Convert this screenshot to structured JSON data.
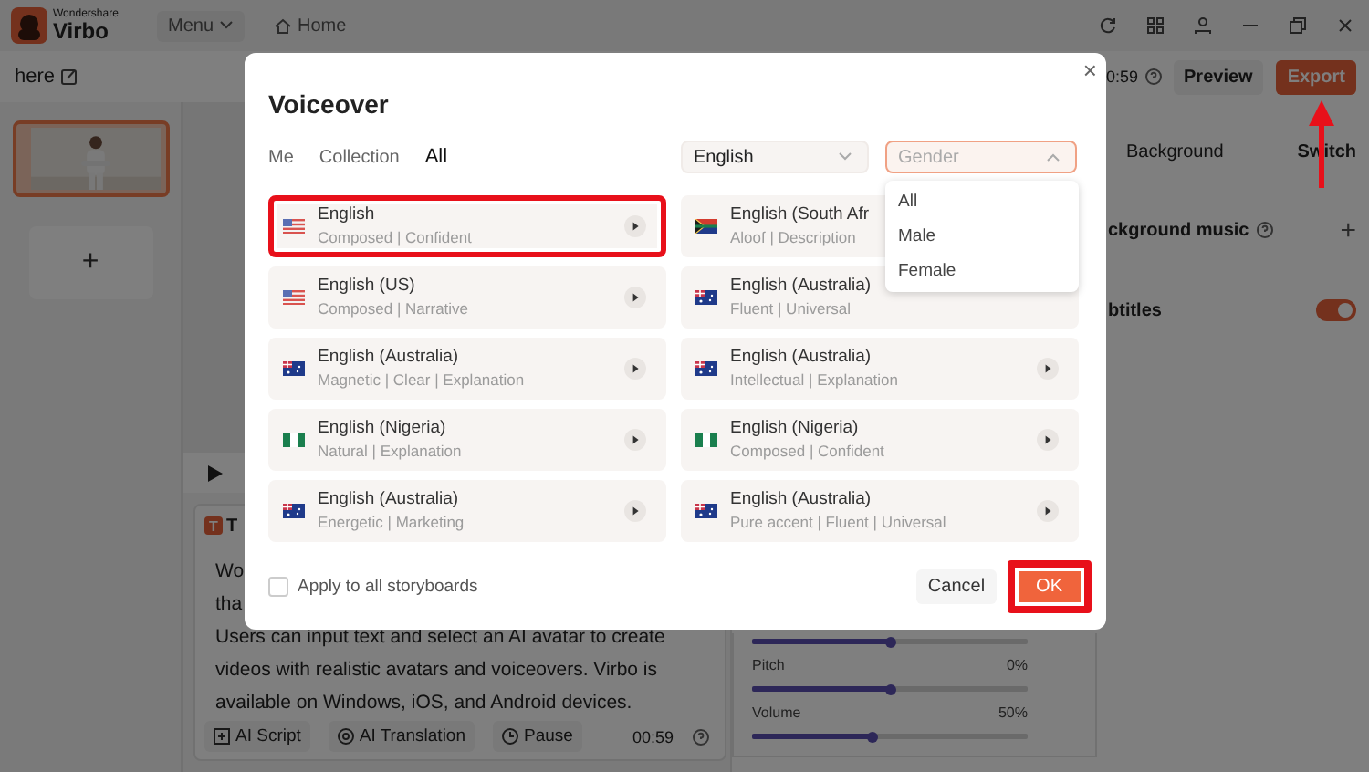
{
  "app": {
    "logo_small": "Wondershare",
    "logo": "Virbo",
    "menu": "Menu",
    "home": "Home"
  },
  "toolbar": {
    "project_name": "here",
    "duration": "0:59",
    "preview": "Preview",
    "export": "Export"
  },
  "storyboards": [
    {
      "kind": "scene",
      "selected": true
    },
    {
      "kind": "add",
      "label": "+"
    }
  ],
  "text_panel": {
    "badge": "T",
    "title": "T",
    "lines": [
      "Wo",
      "tha"
    ],
    "paragraph": "Users can input text and select an AI avatar to create videos with realistic avatars and voiceovers. Virbo is available on Windows, iOS, and Android devices.",
    "buttons": [
      {
        "kind": "script",
        "label": "AI Script"
      },
      {
        "kind": "translate",
        "label": "AI Translation"
      },
      {
        "kind": "pause",
        "label": "Pause"
      }
    ],
    "duration": "00:59"
  },
  "right_panel": {
    "background": "Background",
    "switch": "Switch",
    "music": "ckground music",
    "music_add": "+",
    "subtitles": "btitles",
    "subtitles_on": true,
    "sliders": [
      {
        "level": 0.5
      },
      {
        "label": "Pitch",
        "reading": "0%",
        "level": 0.5
      },
      {
        "label": "Volume",
        "reading": "50%",
        "level": 0.44
      }
    ]
  },
  "dialog": {
    "title": "Voiceover",
    "close": "×",
    "tabs": [
      {
        "label": "Me",
        "selected": false
      },
      {
        "label": "Collection",
        "selected": false
      },
      {
        "label": "All",
        "selected": true
      }
    ],
    "language": {
      "value": "English",
      "expanded": false
    },
    "gender": {
      "placeholder": "Gender",
      "expanded": true,
      "options": [
        "All",
        "Male",
        "Female"
      ]
    },
    "voices": [
      {
        "name": "English",
        "tags": "Composed | Confident",
        "kind": "us",
        "highlighted": true,
        "play_button": true
      },
      {
        "name": "English (South Afr",
        "tags": "Aloof | Description",
        "kind": "za",
        "highlighted": false
      },
      {
        "name": "English (US)",
        "tags": "Composed | Narrative",
        "kind": "us",
        "highlighted": false,
        "play_button": true
      },
      {
        "name": "English (Australia)",
        "tags": "Fluent | Universal",
        "kind": "au",
        "highlighted": false,
        "play_button": false
      },
      {
        "name": "English (Australia)",
        "tags": "Magnetic | Clear | Explanation",
        "kind": "au",
        "highlighted": false,
        "play_button": true
      },
      {
        "name": "English (Australia)",
        "tags": "Intellectual | Explanation",
        "kind": "au",
        "highlighted": false,
        "play_button": true
      },
      {
        "name": "English (Nigeria)",
        "tags": "Natural | Explanation",
        "kind": "ng",
        "highlighted": false,
        "play_button": true
      },
      {
        "name": "English (Nigeria)",
        "tags": "Composed | Confident",
        "kind": "ng",
        "highlighted": false,
        "play_button": true
      },
      {
        "name": "English (Australia)",
        "tags": "Energetic | Marketing",
        "kind": "au",
        "highlighted": false,
        "play_button": true
      },
      {
        "name": "English (Australia)",
        "tags": "Pure accent | Fluent | Universal",
        "kind": "au",
        "highlighted": false,
        "play_button": true
      }
    ],
    "apply_all": {
      "label": "Apply to all storyboards",
      "checked": false
    },
    "cancel": "Cancel",
    "ok": {
      "label": "OK",
      "highlighted": true
    }
  }
}
